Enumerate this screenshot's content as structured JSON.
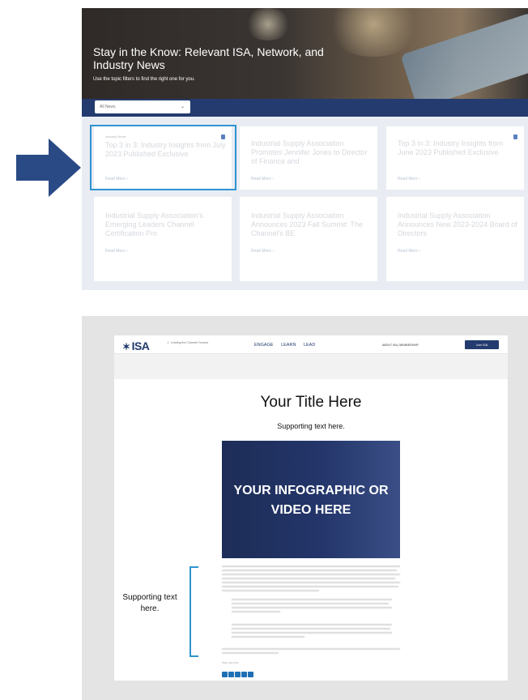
{
  "hero": {
    "title": "Stay in the Know: Relevant ISA, Network, and Industry News",
    "subtitle": "Use the topic filters to find the right one for you."
  },
  "filter": {
    "selected": "All News"
  },
  "cards": [
    {
      "tag": "Industry News",
      "title": "Top 3 in 3: Industry Insights from July 2023 Published Exclusive",
      "more": "Read More ›"
    },
    {
      "tag": "",
      "title": "Industrial Supply Association Promotes Jennifer Jones to Director of Finance and",
      "more": "Read More ›"
    },
    {
      "tag": "",
      "title": "Top 3 in 3: Industry Insights from June 2023 Published Exclusive",
      "more": "Read More ›"
    },
    {
      "tag": "",
      "title": "Industrial Supply Association's Emerging Leaders Channel Certification Pro",
      "more": "Read More ›"
    },
    {
      "tag": "",
      "title": "Industrial Supply Association Announces 2023 Fall Summit: The Channel's BE",
      "more": "Read More ›"
    },
    {
      "tag": "",
      "title": "Industrial Supply Association Announces New 2023-2024 Board of Directors",
      "more": "Read More ›"
    }
  ],
  "mock": {
    "logo": "ISA",
    "tagline": "Leading the Channel Forward",
    "nav": [
      "ENGAGE",
      "LEARN",
      "LEAD"
    ],
    "utility": "ABOUT ISA  |  MEMBERSHIP",
    "join": "Join ISA",
    "title": "Your Title Here",
    "subtitle": "Supporting text here.",
    "infographic": "YOUR INFOGRAPHIC OR VIDEO HERE",
    "share": "Share this Post"
  },
  "annotation": {
    "label": "Supporting text here."
  },
  "colors": {
    "navy": "#233b6e",
    "highlight": "#2f93cf",
    "arrow": "#2a4a86"
  }
}
